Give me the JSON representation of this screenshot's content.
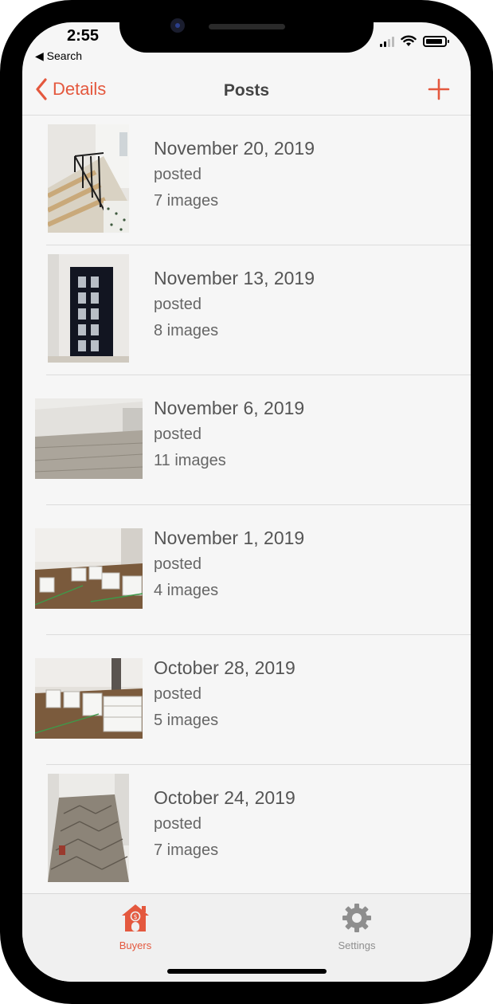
{
  "status_bar": {
    "time": "2:55",
    "back_app": "◀ Search"
  },
  "nav": {
    "back_label": "Details",
    "title": "Posts"
  },
  "posts": [
    {
      "date": "November 20, 2019",
      "status": "posted",
      "count": "7 images"
    },
    {
      "date": "November 13, 2019",
      "status": "posted",
      "count": "8 images"
    },
    {
      "date": "November 6, 2019",
      "status": "posted",
      "count": "11 images"
    },
    {
      "date": "November 1, 2019",
      "status": "posted",
      "count": "4 images"
    },
    {
      "date": "October 28, 2019",
      "status": "posted",
      "count": "5 images"
    },
    {
      "date": "October 24, 2019",
      "status": "posted",
      "count": "7 images"
    }
  ],
  "tabs": [
    {
      "label": "Buyers",
      "icon": "house-dollar-icon",
      "active": true
    },
    {
      "label": "Settings",
      "icon": "gear-icon",
      "active": false
    }
  ],
  "colors": {
    "accent": "#e4583e",
    "inactive": "#8e8e8e",
    "text": "#555555"
  }
}
